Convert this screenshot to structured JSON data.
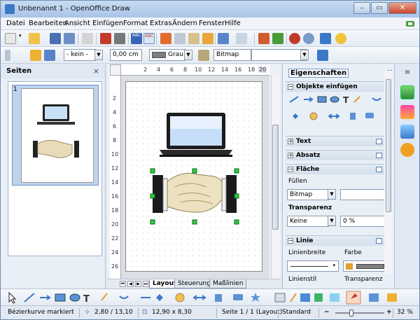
{
  "window": {
    "title": "Unbenannt 1 - OpenOffice Draw",
    "min_glyph": "–",
    "max_glyph": "▭",
    "close_glyph": "✕"
  },
  "menu": [
    "Datei",
    "Bearbeiten",
    "Ansicht",
    "Einfügen",
    "Format",
    "Extras",
    "Ändern",
    "Fenster",
    "Hilfe"
  ],
  "line_toolbar": {
    "line_style": "- kein -",
    "line_width": "0,00 cm",
    "line_color": "Grau",
    "area_style": "Bitmap",
    "area_fill": ""
  },
  "pages_panel": {
    "title": "Seiten",
    "close_glyph": "×",
    "pages": [
      {
        "number": "1"
      }
    ]
  },
  "ruler": {
    "h_ticks": [
      "2",
      "4",
      "6",
      "8",
      "10",
      "12",
      "14",
      "16",
      "18",
      "20"
    ],
    "v_ticks": [
      "2",
      "4",
      "6",
      "8",
      "10",
      "12",
      "14",
      "16",
      "18",
      "20",
      "22",
      "24",
      "26"
    ]
  },
  "tabs": [
    "Layout",
    "Steuerung",
    "Maßlinien"
  ],
  "tab_nav": [
    "⏮",
    "◀",
    "▶",
    "⏭"
  ],
  "sidebar": {
    "title": "Eigenschaften",
    "close_glyph": "×",
    "sections": {
      "insert": "Objekte einfügen",
      "text": "Text",
      "paragraph": "Absatz",
      "area": "Fläche",
      "line": "Linie"
    },
    "area": {
      "fill_label": "Füllen",
      "fill_value": "Bitmap",
      "fill_pattern": "",
      "transparency_label": "Transparenz",
      "transparency_value": "Keine",
      "transparency_pct": "0 %"
    },
    "line": {
      "width_label": "Linienbreite",
      "color_label": "Farbe",
      "style_label": "Linienstil",
      "transparency_label": "Transparenz"
    }
  },
  "statusbar": {
    "message": "Bézierkurve markiert",
    "position": "2,80 / 13,10",
    "size": "12,90 x 8,30",
    "page": "Seite 1 / 1 (Layout)",
    "layout": "Standard",
    "zoom_out": "−",
    "zoom_in": "+",
    "zoom": "32 %",
    "zoom_fraction": 0.33
  },
  "colors": {
    "accent": "#3b78c8",
    "selection_handle": "#2ecc40",
    "line_color_swatch": "#808080"
  }
}
